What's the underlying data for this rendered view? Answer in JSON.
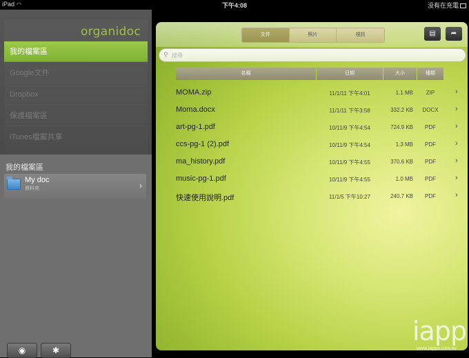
{
  "status": {
    "device": "iPad",
    "time": "下午4:08",
    "battery_text": "没有在充電"
  },
  "sidebar": {
    "logo": "organidoc",
    "menu": [
      {
        "label": "我的檔案區",
        "active": true
      },
      {
        "label": "Google文件",
        "active": false
      },
      {
        "label": "Dropbox",
        "active": false
      },
      {
        "label": "保護檔案區",
        "active": false
      },
      {
        "label": "iTunes檔案共享",
        "active": false
      }
    ],
    "section_title": "我的檔案區",
    "folder": {
      "name": "My doc",
      "sub": "資料夾"
    },
    "bottom_buttons": [
      {
        "icon": "wifi-icon"
      },
      {
        "icon": "gear-icon"
      }
    ]
  },
  "main": {
    "segments": [
      "文件",
      "照片",
      "視訊"
    ],
    "active_segment": 0,
    "search_placeholder": "搜尋",
    "columns": {
      "name": "名稱",
      "date": "日期",
      "size": "大小",
      "type": "種類"
    },
    "files": [
      {
        "name": "MOMA.zip",
        "date": "11/1/11 下午4:01",
        "size": "1.1 MB",
        "type": "ZIP"
      },
      {
        "name": "Moma.docx",
        "date": "11/1/11 下午3:58",
        "size": "332.2 KB",
        "type": "DOCX"
      },
      {
        "name": "art-pg-1.pdf",
        "date": "10/11/9 下午4:54",
        "size": "724.9 KB",
        "type": "PDF"
      },
      {
        "name": "ccs-pg-1 (2).pdf",
        "date": "10/11/9 下午4:54",
        "size": "1.3 MB",
        "type": "PDF"
      },
      {
        "name": "ma_history.pdf",
        "date": "10/11/9 下午4:55",
        "size": "370.6 KB",
        "type": "PDF"
      },
      {
        "name": "music-pg-1.pdf",
        "date": "10/11/9 下午4:55",
        "size": "1.0 MB",
        "type": "PDF"
      },
      {
        "name": "快速使用說明.pdf",
        "date": "11/1/5 下午10:27",
        "size": "240.7 KB",
        "type": "PDF"
      }
    ]
  },
  "watermark": {
    "text": "iapp",
    "url": "www.iappo.com.tw"
  },
  "colors": {
    "accent_green": "#8fbf3d",
    "sidebar_dark": "#4a4a4a",
    "folder_blue": "#3e86c8"
  }
}
